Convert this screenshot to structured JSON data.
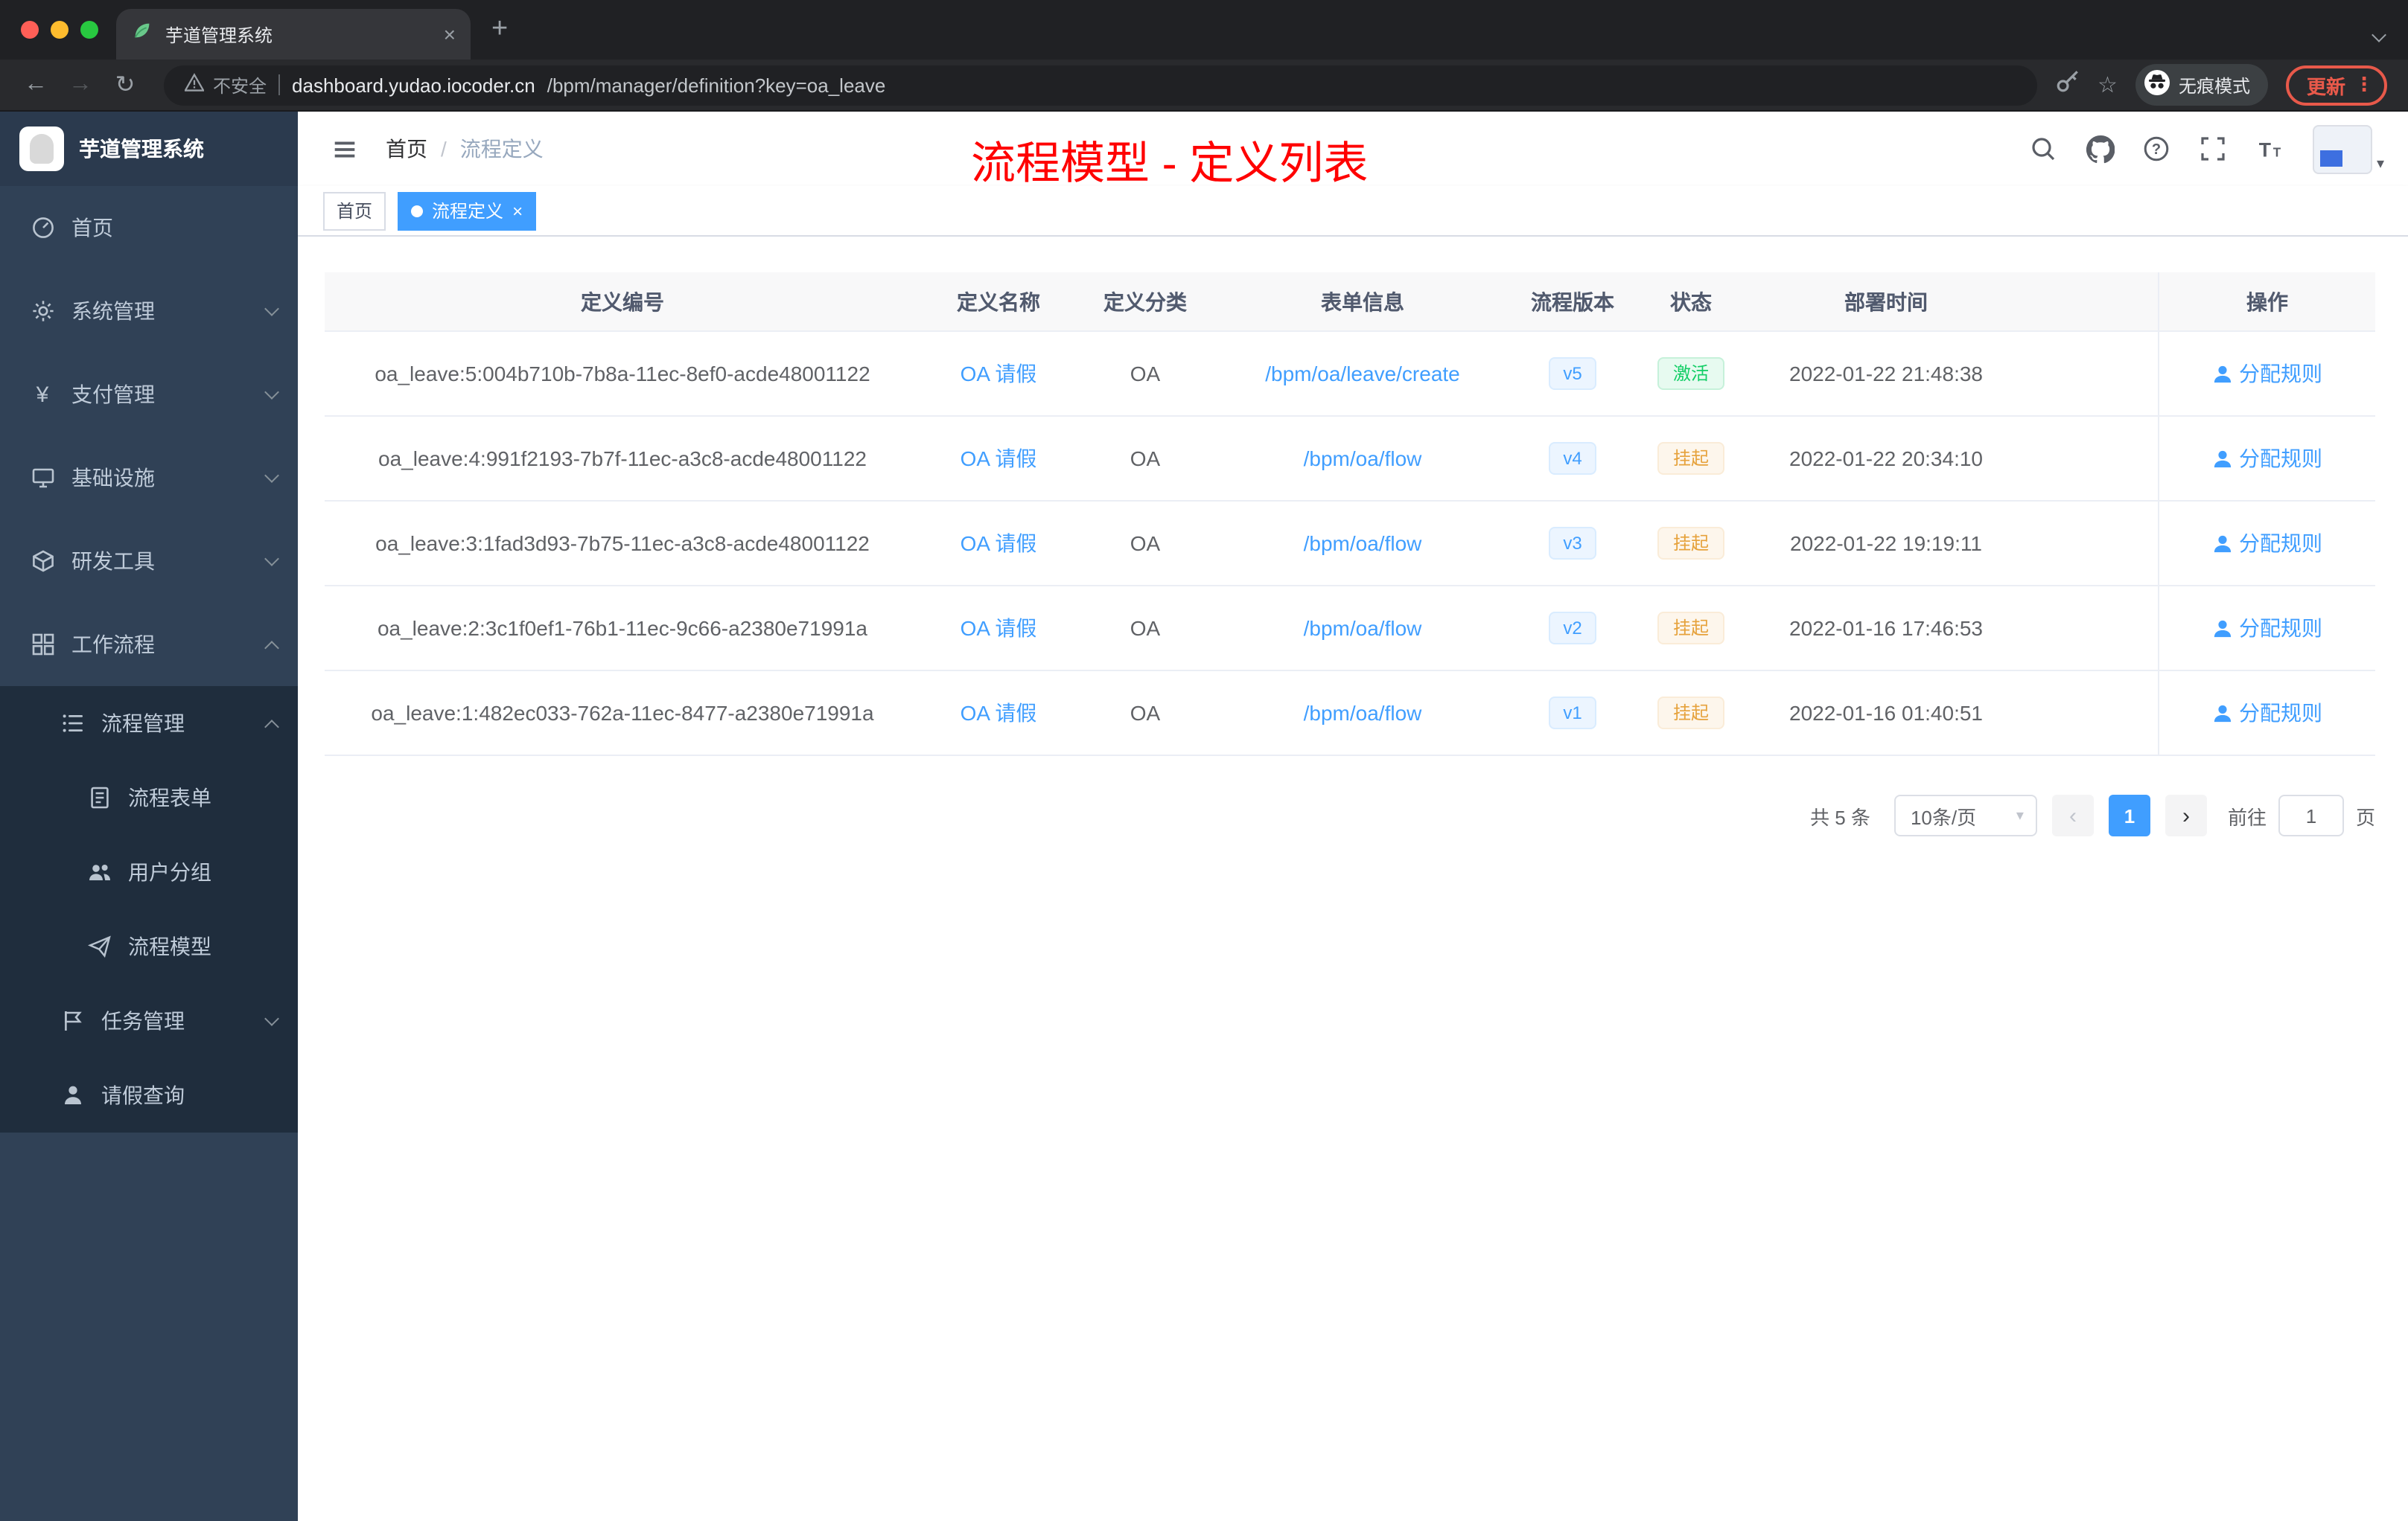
{
  "colors": {
    "accent": "#409eff",
    "success": "#13ce66",
    "warning": "#e6a23c",
    "annotation": "#ff0000",
    "sidebar_bg": "#304156",
    "submenu_bg": "#1f2d3d"
  },
  "icons": {
    "back": "←",
    "forward": "→",
    "reload": "↻",
    "new_tab": "+",
    "close": "×",
    "star": "☆",
    "menu_kebab": "⋮",
    "caret_down": "▾",
    "prev": "‹",
    "next": "›",
    "yen": "¥"
  },
  "browser": {
    "tab_title": "芋道管理系统",
    "nav": {
      "security_label": "不安全",
      "url_host": "dashboard.yudao.iocoder.cn",
      "url_path": "/bpm/manager/definition?key=oa_leave",
      "incognito_label": "无痕模式",
      "update_label": "更新"
    }
  },
  "sidebar": {
    "brand": "芋道管理系统",
    "menu": [
      {
        "label": "首页",
        "icon": "dashboard-icon"
      },
      {
        "label": "系统管理",
        "icon": "gear-icon",
        "arrow": "down"
      },
      {
        "label": "支付管理",
        "icon": "yen-icon",
        "arrow": "down"
      },
      {
        "label": "基础设施",
        "icon": "infrastructure-icon",
        "arrow": "down"
      },
      {
        "label": "研发工具",
        "icon": "devtools-icon",
        "arrow": "down"
      },
      {
        "label": "工作流程",
        "icon": "workflow-icon",
        "arrow": "up",
        "expanded": true
      },
      {
        "label": "流程管理",
        "icon": "process-list-icon",
        "arrow": "up",
        "expanded": true,
        "level": 2
      },
      {
        "label": "流程表单",
        "icon": "form-icon",
        "level": 3
      },
      {
        "label": "用户分组",
        "icon": "user-group-icon",
        "level": 3
      },
      {
        "label": "流程模型",
        "icon": "paper-plane-icon",
        "level": 3
      },
      {
        "label": "任务管理",
        "icon": "task-flag-icon",
        "arrow": "down",
        "level": 2
      },
      {
        "label": "请假查询",
        "icon": "user-icon",
        "level": 2
      }
    ]
  },
  "header": {
    "breadcrumb": {
      "home": "首页",
      "separator": "/",
      "current": "流程定义"
    },
    "annotation": "流程模型 - 定义列表",
    "icons": [
      "search-icon",
      "github-icon",
      "question-icon",
      "fullscreen-icon",
      "font-size-icon",
      "avatar",
      "caret-down-icon"
    ]
  },
  "tags": {
    "items": [
      {
        "label": "首页",
        "active": false
      },
      {
        "label": "流程定义",
        "active": true,
        "closable": true
      }
    ]
  },
  "table": {
    "columns": [
      "定义编号",
      "定义名称",
      "定义分类",
      "表单信息",
      "流程版本",
      "状态",
      "部署时间",
      "操作"
    ],
    "rows": [
      {
        "id": "oa_leave:5:004b710b-7b8a-11ec-8ef0-acde48001122",
        "name": "OA 请假",
        "category": "OA",
        "form": "/bpm/oa/leave/create",
        "version": "v5",
        "status": "激活",
        "status_type": "success",
        "time": "2022-01-22 21:48:38",
        "action": "分配规则"
      },
      {
        "id": "oa_leave:4:991f2193-7b7f-11ec-a3c8-acde48001122",
        "name": "OA 请假",
        "category": "OA",
        "form": "/bpm/oa/flow",
        "version": "v4",
        "status": "挂起",
        "status_type": "warning",
        "time": "2022-01-22 20:34:10",
        "action": "分配规则"
      },
      {
        "id": "oa_leave:3:1fad3d93-7b75-11ec-a3c8-acde48001122",
        "name": "OA 请假",
        "category": "OA",
        "form": "/bpm/oa/flow",
        "version": "v3",
        "status": "挂起",
        "status_type": "warning",
        "time": "2022-01-22 19:19:11",
        "action": "分配规则"
      },
      {
        "id": "oa_leave:2:3c1f0ef1-76b1-11ec-9c66-a2380e71991a",
        "name": "OA 请假",
        "category": "OA",
        "form": "/bpm/oa/flow",
        "version": "v2",
        "status": "挂起",
        "status_type": "warning",
        "time": "2022-01-16 17:46:53",
        "action": "分配规则"
      },
      {
        "id": "oa_leave:1:482ec033-762a-11ec-8477-a2380e71991a",
        "name": "OA 请假",
        "category": "OA",
        "form": "/bpm/oa/flow",
        "version": "v1",
        "status": "挂起",
        "status_type": "warning",
        "time": "2022-01-16 01:40:51",
        "action": "分配规则"
      }
    ]
  },
  "pagination": {
    "total": "共 5 条",
    "page_size": "10条/页",
    "current_page": "1",
    "goto_label": "前往",
    "goto_value": "1",
    "goto_unit": "页"
  }
}
